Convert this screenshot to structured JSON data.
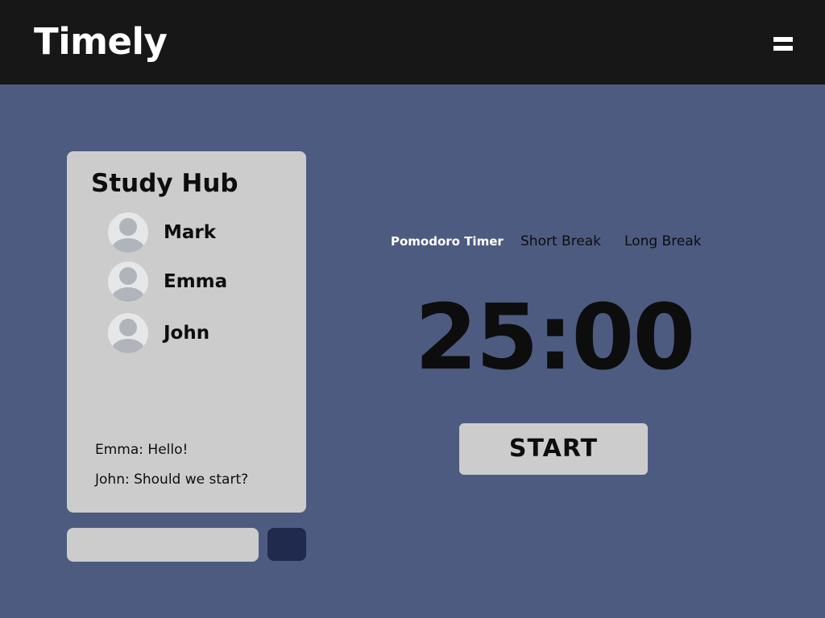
{
  "app": {
    "title": "Timely",
    "menu_icon": "hamburger-menu-icon"
  },
  "colors": {
    "header_bg": "#171717",
    "page_bg": "#4d5b80",
    "panel_bg": "#cccccc",
    "send_button_bg": "#1f2a4d",
    "active_tab_text": "#ffffff"
  },
  "study_hub": {
    "title": "Study Hub",
    "members": [
      {
        "name": "Mark",
        "avatar_icon": "user-avatar-icon"
      },
      {
        "name": "Emma",
        "avatar_icon": "user-avatar-icon"
      },
      {
        "name": "John",
        "avatar_icon": "user-avatar-icon"
      }
    ],
    "messages": [
      "Emma: Hello!",
      "John: Should we start?"
    ]
  },
  "chat": {
    "input_value": "",
    "input_placeholder": ""
  },
  "timer": {
    "tabs": [
      {
        "label": "Pomodoro Timer",
        "active": true
      },
      {
        "label": "Short Break",
        "active": false
      },
      {
        "label": "Long Break",
        "active": false
      }
    ],
    "display": "25:00",
    "start_label": "START"
  }
}
